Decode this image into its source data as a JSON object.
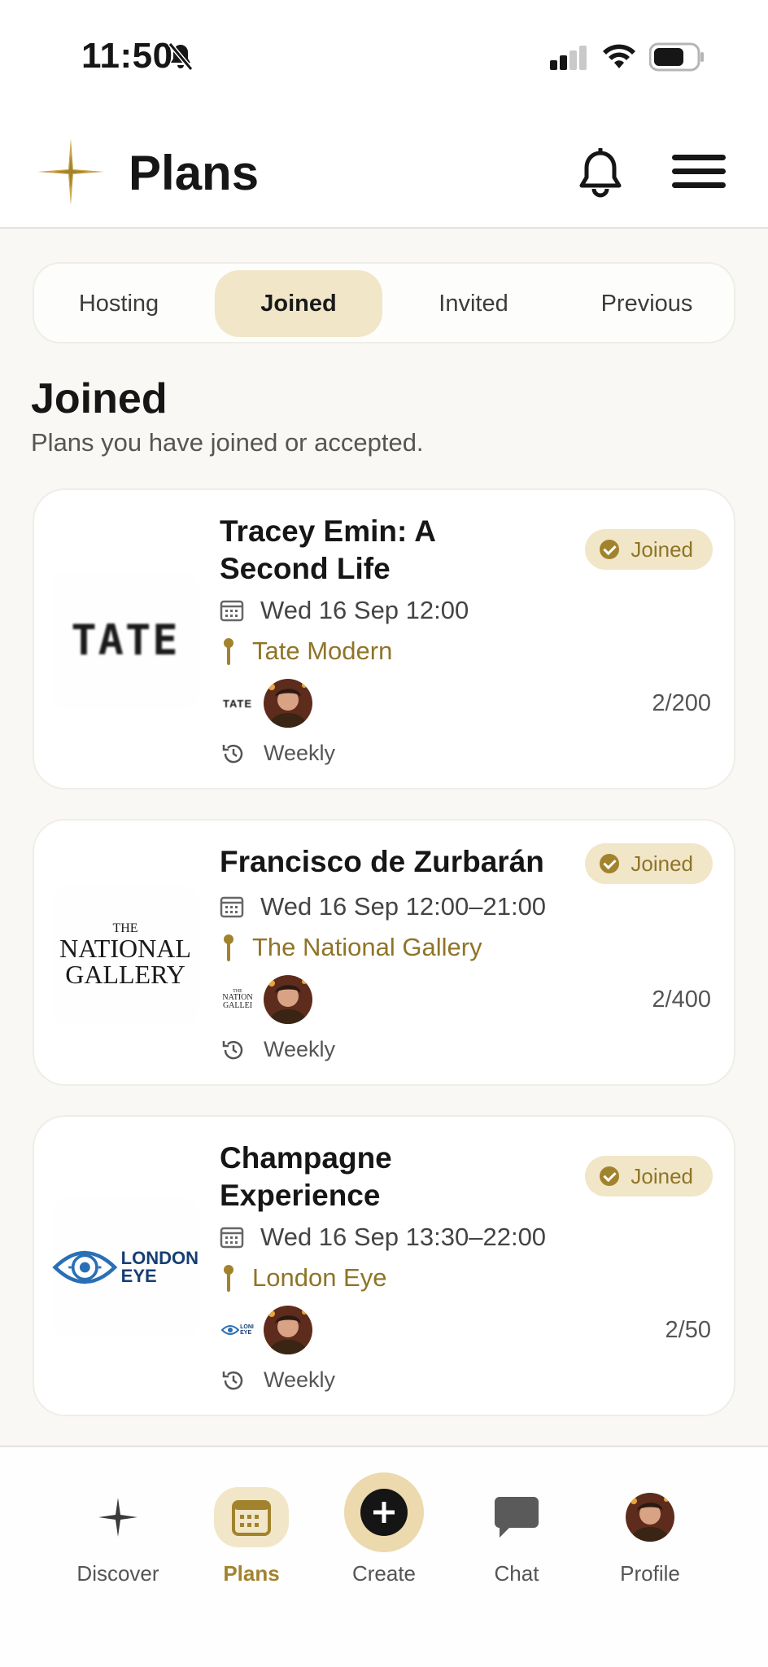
{
  "status_bar": {
    "time": "11:50"
  },
  "header": {
    "title": "Plans"
  },
  "tabs": [
    {
      "label": "Hosting",
      "active": false
    },
    {
      "label": "Joined",
      "active": true
    },
    {
      "label": "Invited",
      "active": false
    },
    {
      "label": "Previous",
      "active": false
    }
  ],
  "section": {
    "title": "Joined",
    "subtitle": "Plans you have joined or accepted."
  },
  "plans": [
    {
      "title": "Tracey Emin: A Second Life",
      "badge": "Joined",
      "date": "Wed 16 Sep 12:00",
      "venue": "Tate Modern",
      "venue_logo_text": "TATE",
      "mini_logo_text": "TATE",
      "attendees": "2/200",
      "recurrence": "Weekly"
    },
    {
      "title": "Francisco de Zurbarán",
      "badge": "Joined",
      "date": "Wed 16 Sep 12:00–21:00",
      "venue": "The National Gallery",
      "venue_logo_text": {
        "line1": "THE",
        "line2": "NATIONAL",
        "line3": "GALLERY"
      },
      "mini_logo_text": {
        "line1": "THE",
        "line2": "NATION",
        "line3": "GALLEI"
      },
      "attendees": "2/400",
      "recurrence": "Weekly"
    },
    {
      "title": "Champagne Experience",
      "badge": "Joined",
      "date": "Wed 16 Sep 13:30–22:00",
      "venue": "London Eye",
      "venue_logo_text": {
        "line1": "LONDON",
        "line2": "EYE"
      },
      "mini_logo_text": {
        "line1": "LONI",
        "line2": "EYE"
      },
      "attendees": "2/50",
      "recurrence": "Weekly"
    }
  ],
  "bottom_nav": [
    {
      "label": "Discover",
      "icon": "sparkle-icon",
      "active": false
    },
    {
      "label": "Plans",
      "icon": "calendar-icon",
      "active": true
    },
    {
      "label": "Create",
      "icon": "plus-circle-icon",
      "active": false
    },
    {
      "label": "Chat",
      "icon": "chat-bubble-icon",
      "active": false
    },
    {
      "label": "Profile",
      "icon": "avatar",
      "active": false
    }
  ],
  "colors": {
    "accent": "#a2832d",
    "accent_light": "#f1e6c8",
    "background": "#f9f8f4"
  }
}
